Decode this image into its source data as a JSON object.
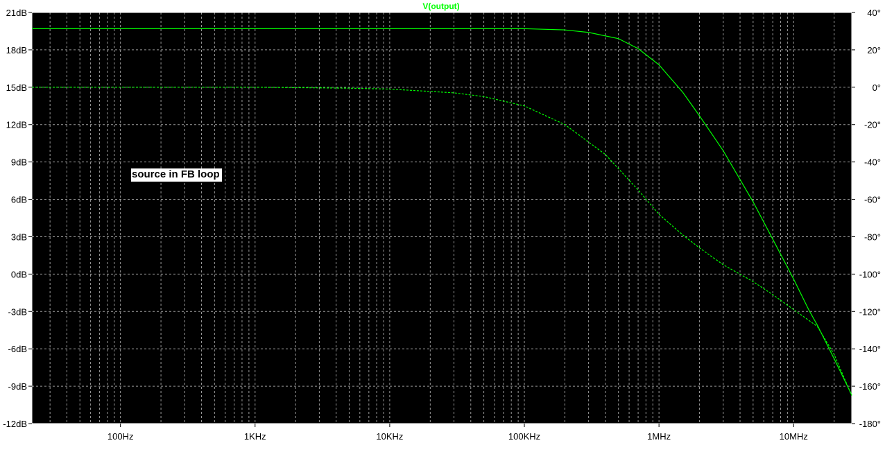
{
  "window": {
    "title": "V(output)"
  },
  "annotation": "source in FB loop",
  "colors": {
    "background": "#000000",
    "trace": "#00ff00",
    "grid": "#9a9a9a",
    "frame": "#ffffff",
    "page": "#ffffff"
  },
  "chart_data": {
    "type": "line",
    "title": "V(output)",
    "x_scale": "log",
    "xlim": [
      22,
      27000000
    ],
    "x_tick_labels": [
      {
        "value": 100,
        "label": "100Hz"
      },
      {
        "value": 1000,
        "label": "1KHz"
      },
      {
        "value": 10000,
        "label": "10KHz"
      },
      {
        "value": 100000,
        "label": "100KHz"
      },
      {
        "value": 1000000,
        "label": "1MHz"
      },
      {
        "value": 10000000,
        "label": "10MHz"
      }
    ],
    "y_left": {
      "unit": "dB",
      "lim": [
        -12,
        21
      ],
      "ticks": [
        "21dB",
        "18dB",
        "15dB",
        "12dB",
        "9dB",
        "6dB",
        "3dB",
        "0dB",
        "-3dB",
        "-6dB",
        "-9dB",
        "-12dB"
      ]
    },
    "y_right": {
      "unit": "°",
      "lim": [
        -180,
        40
      ],
      "ticks": [
        "40°",
        "20°",
        "0°",
        "-20°",
        "-40°",
        "-60°",
        "-80°",
        "-100°",
        "-120°",
        "-140°",
        "-160°",
        "-180°"
      ]
    },
    "grid": true,
    "series": [
      {
        "name": "V(output)",
        "quantity": "magnitude",
        "axis": "left",
        "style": "solid",
        "points": [
          [
            22,
            19.7
          ],
          [
            1000,
            19.7
          ],
          [
            100000,
            19.7
          ],
          [
            200000,
            19.6
          ],
          [
            300000,
            19.4
          ],
          [
            500000,
            18.9
          ],
          [
            700000,
            18.1
          ],
          [
            1000000,
            16.8
          ],
          [
            1500000,
            14.6
          ],
          [
            2000000,
            12.7
          ],
          [
            3000000,
            9.9
          ],
          [
            5000000,
            5.8
          ],
          [
            7000000,
            2.8
          ],
          [
            10000000,
            -0.4
          ],
          [
            13000000,
            -2.9
          ],
          [
            15000000,
            -4.1
          ],
          [
            20000000,
            -6.8
          ],
          [
            27000000,
            -9.7
          ]
        ]
      },
      {
        "name": "V(output)",
        "quantity": "phase",
        "axis": "right",
        "style": "dashed",
        "points": [
          [
            22,
            0
          ],
          [
            1000,
            0
          ],
          [
            5000,
            -0.5
          ],
          [
            10000,
            -1
          ],
          [
            30000,
            -3
          ],
          [
            50000,
            -5
          ],
          [
            100000,
            -10
          ],
          [
            200000,
            -20
          ],
          [
            400000,
            -36
          ],
          [
            700000,
            -55
          ],
          [
            1000000,
            -68
          ],
          [
            1500000,
            -79
          ],
          [
            2000000,
            -86
          ],
          [
            3000000,
            -95
          ],
          [
            5000000,
            -104
          ],
          [
            7000000,
            -111
          ],
          [
            10000000,
            -119
          ],
          [
            15000000,
            -128
          ],
          [
            20000000,
            -143
          ],
          [
            27000000,
            -165
          ]
        ]
      }
    ]
  }
}
